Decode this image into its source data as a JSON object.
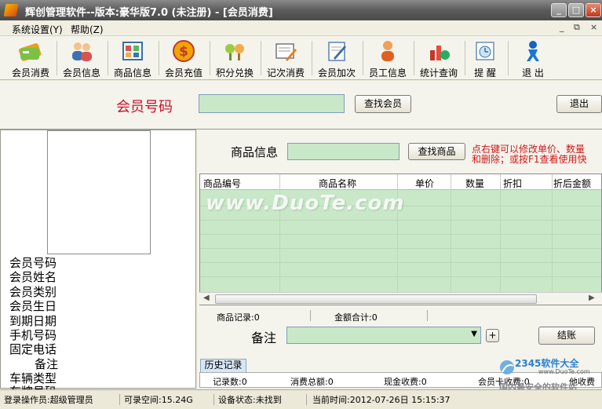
{
  "window": {
    "title": "辉创管理软件--版本:豪华版7.0 (未注册) - [会员消费]",
    "controls": [
      "_",
      "□",
      "×"
    ]
  },
  "menubar": {
    "items": [
      {
        "label": "系统设置(Y)"
      },
      {
        "label": "帮助(Z)"
      }
    ],
    "mdi_controls": [
      "_",
      "⧉",
      "×"
    ]
  },
  "toolbar": {
    "items": [
      {
        "label": "会员消费",
        "icon": "card-icon"
      },
      {
        "label": "会员信息",
        "icon": "members-icon"
      },
      {
        "label": "商品信息",
        "icon": "goods-icon"
      },
      {
        "label": "会员充值",
        "icon": "dollar-coin-icon"
      },
      {
        "label": "积分兑换",
        "icon": "points-exchange-icon"
      },
      {
        "label": "记次消费",
        "icon": "count-consume-icon"
      },
      {
        "label": "会员加次",
        "icon": "add-count-icon"
      },
      {
        "label": "员工信息",
        "icon": "staff-icon"
      },
      {
        "label": "统计查询",
        "icon": "statistics-icon"
      },
      {
        "label": "提 醒",
        "icon": "reminder-icon"
      },
      {
        "label": "退 出",
        "icon": "exit-icon"
      }
    ]
  },
  "member_search": {
    "label": "会员号码",
    "value": "",
    "button": "查找会员",
    "exit_button": "退出"
  },
  "member_info": {
    "fields": [
      {
        "label": "会员号码"
      },
      {
        "label": "会员姓名"
      },
      {
        "label": "会员类别"
      },
      {
        "label": "会员生日"
      },
      {
        "label": "到期日期"
      },
      {
        "label": "手机号码"
      },
      {
        "label": "固定电话"
      },
      {
        "label": "备注"
      },
      {
        "label": "车辆类型"
      },
      {
        "label": "车牌号码"
      }
    ]
  },
  "goods_search": {
    "label": "商品信息",
    "value": "",
    "button": "查找商品",
    "hint_line1": "点右键可以修改单价、数量",
    "hint_line2": "和删除；或按F1查看使用快"
  },
  "goods_table": {
    "columns": [
      "商品编号",
      "商品名称",
      "单价",
      "数量",
      "折扣",
      "折后金额"
    ],
    "rows": []
  },
  "watermark": "www.DuoTe.com",
  "summary": {
    "goods_records": "商品记录:0",
    "amount_total": "金额合计:0"
  },
  "remark": {
    "label": "备注",
    "add_button": "+",
    "checkout_button": "结账"
  },
  "history": {
    "tab_label": "历史记录",
    "records": "记录数:0",
    "consume_total": "消费总额:0",
    "cash_income": "现金收费:0",
    "card_income": "会员卡收费:0",
    "other_income": "他收费"
  },
  "status": {
    "operator": "登录操作员:超级管理员",
    "free_space": "可录空间:15.24G",
    "device": "设备状态:未找到",
    "current_time": "当前时间:2012-07-26日 15:15:37"
  },
  "logo": {
    "brand": "2345软件大全",
    "site": "www.DuoTe.com",
    "slogan": "国内最安全的软件站"
  },
  "colors": {
    "input_bg": "#c8e8c8",
    "label_red": "#c8102e",
    "hint_red": "#d01818"
  }
}
